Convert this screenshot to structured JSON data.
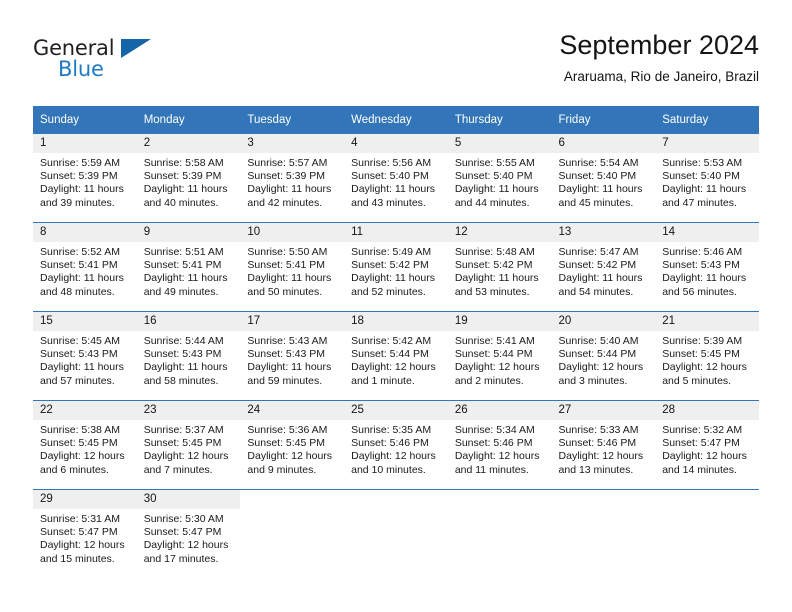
{
  "logo": {
    "word_one": "General",
    "word_two": "Blue",
    "triangle_color": "#1565a8",
    "blue_color": "#1f7ac4"
  },
  "header": {
    "title": "September 2024",
    "subtitle": "Araruama, Rio de Janeiro, Brazil"
  },
  "theme": {
    "header_bg": "#3275b8",
    "daynum_bg": "#efefef",
    "row_divider": "#3275b8"
  },
  "calendar": {
    "weekday_headers": [
      "Sunday",
      "Monday",
      "Tuesday",
      "Wednesday",
      "Thursday",
      "Friday",
      "Saturday"
    ],
    "weeks": [
      [
        {
          "day": "1",
          "sunrise": "Sunrise: 5:59 AM",
          "sunset": "Sunset: 5:39 PM",
          "daylight": "Daylight: 11 hours and 39 minutes."
        },
        {
          "day": "2",
          "sunrise": "Sunrise: 5:58 AM",
          "sunset": "Sunset: 5:39 PM",
          "daylight": "Daylight: 11 hours and 40 minutes."
        },
        {
          "day": "3",
          "sunrise": "Sunrise: 5:57 AM",
          "sunset": "Sunset: 5:39 PM",
          "daylight": "Daylight: 11 hours and 42 minutes."
        },
        {
          "day": "4",
          "sunrise": "Sunrise: 5:56 AM",
          "sunset": "Sunset: 5:40 PM",
          "daylight": "Daylight: 11 hours and 43 minutes."
        },
        {
          "day": "5",
          "sunrise": "Sunrise: 5:55 AM",
          "sunset": "Sunset: 5:40 PM",
          "daylight": "Daylight: 11 hours and 44 minutes."
        },
        {
          "day": "6",
          "sunrise": "Sunrise: 5:54 AM",
          "sunset": "Sunset: 5:40 PM",
          "daylight": "Daylight: 11 hours and 45 minutes."
        },
        {
          "day": "7",
          "sunrise": "Sunrise: 5:53 AM",
          "sunset": "Sunset: 5:40 PM",
          "daylight": "Daylight: 11 hours and 47 minutes."
        }
      ],
      [
        {
          "day": "8",
          "sunrise": "Sunrise: 5:52 AM",
          "sunset": "Sunset: 5:41 PM",
          "daylight": "Daylight: 11 hours and 48 minutes."
        },
        {
          "day": "9",
          "sunrise": "Sunrise: 5:51 AM",
          "sunset": "Sunset: 5:41 PM",
          "daylight": "Daylight: 11 hours and 49 minutes."
        },
        {
          "day": "10",
          "sunrise": "Sunrise: 5:50 AM",
          "sunset": "Sunset: 5:41 PM",
          "daylight": "Daylight: 11 hours and 50 minutes."
        },
        {
          "day": "11",
          "sunrise": "Sunrise: 5:49 AM",
          "sunset": "Sunset: 5:42 PM",
          "daylight": "Daylight: 11 hours and 52 minutes."
        },
        {
          "day": "12",
          "sunrise": "Sunrise: 5:48 AM",
          "sunset": "Sunset: 5:42 PM",
          "daylight": "Daylight: 11 hours and 53 minutes."
        },
        {
          "day": "13",
          "sunrise": "Sunrise: 5:47 AM",
          "sunset": "Sunset: 5:42 PM",
          "daylight": "Daylight: 11 hours and 54 minutes."
        },
        {
          "day": "14",
          "sunrise": "Sunrise: 5:46 AM",
          "sunset": "Sunset: 5:43 PM",
          "daylight": "Daylight: 11 hours and 56 minutes."
        }
      ],
      [
        {
          "day": "15",
          "sunrise": "Sunrise: 5:45 AM",
          "sunset": "Sunset: 5:43 PM",
          "daylight": "Daylight: 11 hours and 57 minutes."
        },
        {
          "day": "16",
          "sunrise": "Sunrise: 5:44 AM",
          "sunset": "Sunset: 5:43 PM",
          "daylight": "Daylight: 11 hours and 58 minutes."
        },
        {
          "day": "17",
          "sunrise": "Sunrise: 5:43 AM",
          "sunset": "Sunset: 5:43 PM",
          "daylight": "Daylight: 11 hours and 59 minutes."
        },
        {
          "day": "18",
          "sunrise": "Sunrise: 5:42 AM",
          "sunset": "Sunset: 5:44 PM",
          "daylight": "Daylight: 12 hours and 1 minute."
        },
        {
          "day": "19",
          "sunrise": "Sunrise: 5:41 AM",
          "sunset": "Sunset: 5:44 PM",
          "daylight": "Daylight: 12 hours and 2 minutes."
        },
        {
          "day": "20",
          "sunrise": "Sunrise: 5:40 AM",
          "sunset": "Sunset: 5:44 PM",
          "daylight": "Daylight: 12 hours and 3 minutes."
        },
        {
          "day": "21",
          "sunrise": "Sunrise: 5:39 AM",
          "sunset": "Sunset: 5:45 PM",
          "daylight": "Daylight: 12 hours and 5 minutes."
        }
      ],
      [
        {
          "day": "22",
          "sunrise": "Sunrise: 5:38 AM",
          "sunset": "Sunset: 5:45 PM",
          "daylight": "Daylight: 12 hours and 6 minutes."
        },
        {
          "day": "23",
          "sunrise": "Sunrise: 5:37 AM",
          "sunset": "Sunset: 5:45 PM",
          "daylight": "Daylight: 12 hours and 7 minutes."
        },
        {
          "day": "24",
          "sunrise": "Sunrise: 5:36 AM",
          "sunset": "Sunset: 5:45 PM",
          "daylight": "Daylight: 12 hours and 9 minutes."
        },
        {
          "day": "25",
          "sunrise": "Sunrise: 5:35 AM",
          "sunset": "Sunset: 5:46 PM",
          "daylight": "Daylight: 12 hours and 10 minutes."
        },
        {
          "day": "26",
          "sunrise": "Sunrise: 5:34 AM",
          "sunset": "Sunset: 5:46 PM",
          "daylight": "Daylight: 12 hours and 11 minutes."
        },
        {
          "day": "27",
          "sunrise": "Sunrise: 5:33 AM",
          "sunset": "Sunset: 5:46 PM",
          "daylight": "Daylight: 12 hours and 13 minutes."
        },
        {
          "day": "28",
          "sunrise": "Sunrise: 5:32 AM",
          "sunset": "Sunset: 5:47 PM",
          "daylight": "Daylight: 12 hours and 14 minutes."
        }
      ],
      [
        {
          "day": "29",
          "sunrise": "Sunrise: 5:31 AM",
          "sunset": "Sunset: 5:47 PM",
          "daylight": "Daylight: 12 hours and 15 minutes."
        },
        {
          "day": "30",
          "sunrise": "Sunrise: 5:30 AM",
          "sunset": "Sunset: 5:47 PM",
          "daylight": "Daylight: 12 hours and 17 minutes."
        },
        {
          "day": "",
          "sunrise": "",
          "sunset": "",
          "daylight": ""
        },
        {
          "day": "",
          "sunrise": "",
          "sunset": "",
          "daylight": ""
        },
        {
          "day": "",
          "sunrise": "",
          "sunset": "",
          "daylight": ""
        },
        {
          "day": "",
          "sunrise": "",
          "sunset": "",
          "daylight": ""
        },
        {
          "day": "",
          "sunrise": "",
          "sunset": "",
          "daylight": ""
        }
      ]
    ]
  }
}
